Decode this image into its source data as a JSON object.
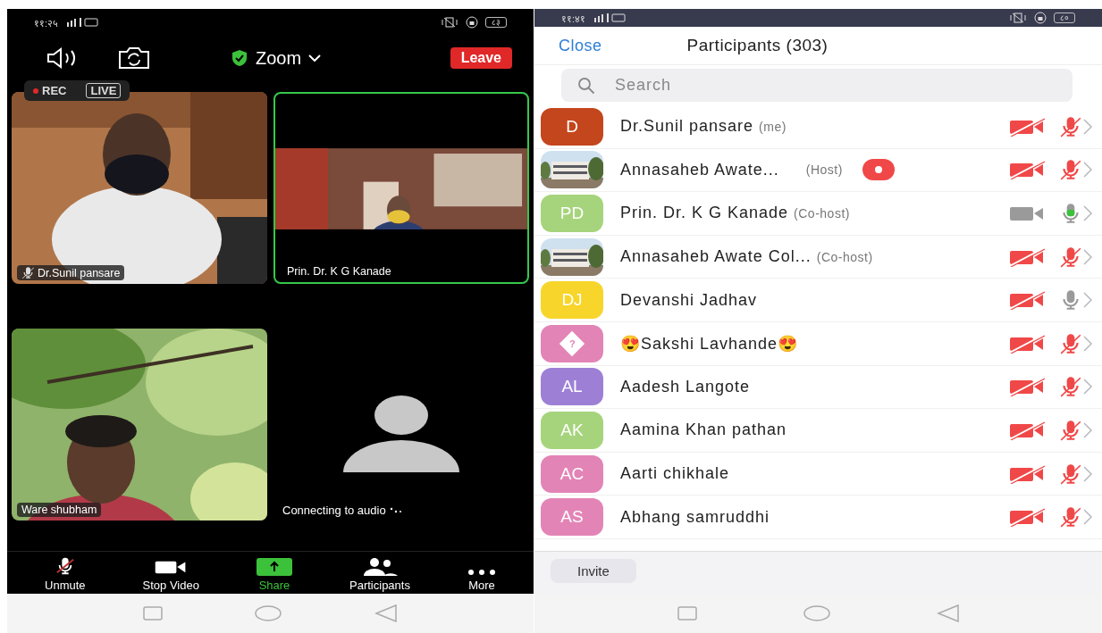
{
  "call_screen": {
    "status_bar": {
      "time": "११:२५",
      "battery": "८३"
    },
    "meeting_title": "Zoom",
    "leave_button": "Leave",
    "recording": {
      "rec": "REC",
      "live": "LIVE"
    },
    "tiles": [
      {
        "kind": "video",
        "name": "Dr.Sunil pansare",
        "muted": true,
        "active_speaker": false
      },
      {
        "kind": "video",
        "name": "Prin. Dr. K G Kanade",
        "muted": false,
        "active_speaker": true
      },
      {
        "kind": "video",
        "name": "Ware shubham",
        "muted": false,
        "active_speaker": false
      },
      {
        "kind": "no_video",
        "status": "Connecting to audio"
      }
    ],
    "toolbar": [
      {
        "kind": "mic_muted",
        "label": "Unmute",
        "highlighted": false
      },
      {
        "kind": "video",
        "label": "Stop Video",
        "highlighted": false
      },
      {
        "kind": "share",
        "label": "Share",
        "highlighted": true
      },
      {
        "kind": "participants",
        "label": "Participants",
        "highlighted": false
      },
      {
        "kind": "more",
        "label": "More",
        "highlighted": false
      }
    ]
  },
  "participants_screen": {
    "status_bar": {
      "time": "११:४१",
      "battery": "८०"
    },
    "close": "Close",
    "title": "Participants (303)",
    "search": {
      "placeholder": "Search"
    },
    "participants": [
      {
        "avatar": {
          "kind": "initials",
          "text": "D",
          "color": "#c4461c"
        },
        "name": "Dr.Sunil pansare",
        "tag": "(me)",
        "recording": false,
        "video_off": true,
        "muted": true,
        "speaking": false
      },
      {
        "name": "Annasaheb Awate...",
        "tag": "(Host)",
        "recording": true,
        "video_off": true,
        "muted": true,
        "speaking": false
      },
      {
        "avatar": {
          "kind": "initials",
          "text": "PD",
          "color": "#a6d47c"
        },
        "name": "Prin. Dr. K G Kanade",
        "tag": "(Co-host)",
        "recording": false,
        "video_off": false,
        "muted": false,
        "speaking": true
      },
      {
        "name": "Annasaheb Awate Col...",
        "tag": "(Co-host)",
        "recording": false,
        "video_off": true,
        "muted": true,
        "speaking": false
      },
      {
        "avatar": {
          "kind": "initials",
          "text": "DJ",
          "color": "#f7d52a"
        },
        "name": "Devanshi Jadhav",
        "recording": false,
        "video_off": true,
        "muted": false,
        "speaking": false
      },
      {
        "avatar": {
          "kind": "unknown",
          "text": "?",
          "color": "#e384b6"
        },
        "name": "😍Sakshi Lavhande😍",
        "recording": false,
        "video_off": true,
        "muted": true,
        "speaking": false
      },
      {
        "avatar": {
          "kind": "initials",
          "text": "AL",
          "color": "#9d80d6"
        },
        "name": "Aadesh Langote",
        "recording": false,
        "video_off": true,
        "muted": true,
        "speaking": false
      },
      {
        "avatar": {
          "kind": "initials",
          "text": "AK",
          "color": "#a6d47c"
        },
        "name": "Aamina Khan pathan",
        "recording": false,
        "video_off": true,
        "muted": true,
        "speaking": false
      },
      {
        "avatar": {
          "kind": "initials",
          "text": "AC",
          "color": "#e384b6"
        },
        "name": "Aarti chikhale",
        "recording": false,
        "video_off": true,
        "muted": true,
        "speaking": false
      },
      {
        "avatar": {
          "kind": "initials",
          "text": "AS",
          "color": "#e384b6"
        },
        "name": "Abhang samruddhi",
        "recording": false,
        "video_off": true,
        "muted": true,
        "speaking": false
      }
    ],
    "invite_button": "Invite"
  }
}
